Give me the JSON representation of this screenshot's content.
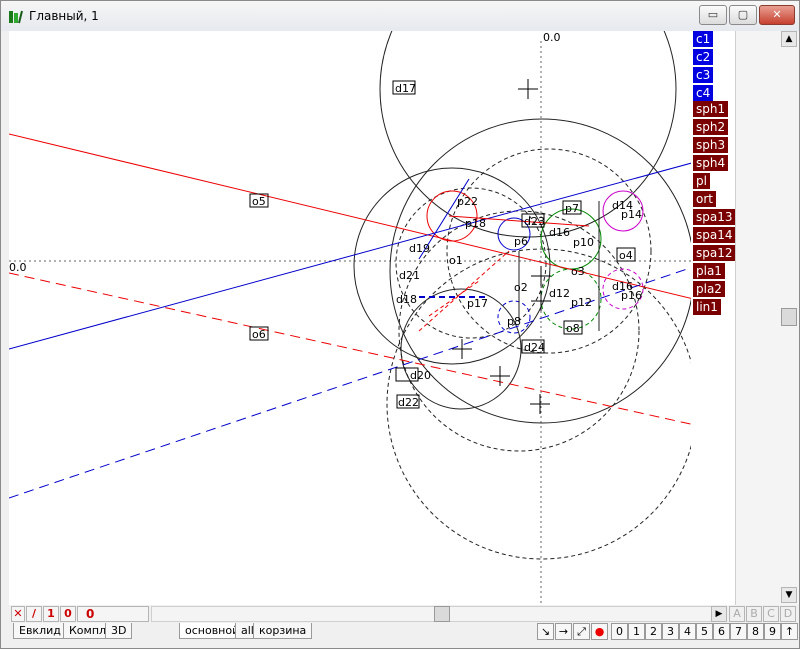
{
  "window": {
    "title": "Главный, 1",
    "min_glyph": "▭",
    "max_glyph": "▢",
    "close_glyph": "✕"
  },
  "canvas": {
    "origin_x_label": "0.0",
    "origin_y_label": "0.0",
    "labels": [
      {
        "id": "d17",
        "text": "d17"
      },
      {
        "id": "o5",
        "text": "o5"
      },
      {
        "id": "o6",
        "text": "o6"
      },
      {
        "id": "d19",
        "text": "d19"
      },
      {
        "id": "d21",
        "text": "d21"
      },
      {
        "id": "d18",
        "text": "d18"
      },
      {
        "id": "d20",
        "text": "d20"
      },
      {
        "id": "d22",
        "text": "d22"
      },
      {
        "id": "d24",
        "text": "d24"
      },
      {
        "id": "p22",
        "text": "p22"
      },
      {
        "id": "p18",
        "text": "p18"
      },
      {
        "id": "d23",
        "text": "d23"
      },
      {
        "id": "p7",
        "text": "p7"
      },
      {
        "id": "d16",
        "text": "d16"
      },
      {
        "id": "p10",
        "text": "p10"
      },
      {
        "id": "d14",
        "text": "d14"
      },
      {
        "id": "p14",
        "text": "p14"
      },
      {
        "id": "o4",
        "text": "o4"
      },
      {
        "id": "o3",
        "text": "o3"
      },
      {
        "id": "o1",
        "text": "o1"
      },
      {
        "id": "o2",
        "text": "o2"
      },
      {
        "id": "d12",
        "text": "d12"
      },
      {
        "id": "p12",
        "text": "p12"
      },
      {
        "id": "d16b",
        "text": "d16"
      },
      {
        "id": "p16",
        "text": "p16"
      },
      {
        "id": "p6",
        "text": "p6"
      },
      {
        "id": "p8",
        "text": "p8"
      },
      {
        "id": "o8",
        "text": "o8"
      },
      {
        "id": "p17",
        "text": "p17"
      }
    ]
  },
  "object_list": [
    {
      "name": "c1",
      "color": "#0000e0"
    },
    {
      "name": "c2",
      "color": "#0000e0"
    },
    {
      "name": "c3",
      "color": "#0000e0"
    },
    {
      "name": "c4",
      "color": "#0000e0"
    },
    {
      "name": "sph1",
      "color": "#7a0000"
    },
    {
      "name": "sph2",
      "color": "#7a0000"
    },
    {
      "name": "sph3",
      "color": "#7a0000"
    },
    {
      "name": "sph4",
      "color": "#7a0000"
    },
    {
      "name": "pl",
      "color": "#7a0000"
    },
    {
      "name": "ort",
      "color": "#7a0000"
    },
    {
      "name": "spa13",
      "color": "#7a0000"
    },
    {
      "name": "spa14",
      "color": "#7a0000"
    },
    {
      "name": "spa12",
      "color": "#7a0000"
    },
    {
      "name": "pla1",
      "color": "#7a0000"
    },
    {
      "name": "pla2",
      "color": "#7a0000"
    },
    {
      "name": "lin1",
      "color": "#7a0000"
    }
  ],
  "toolbar": {
    "tool_x": "✕",
    "tool_line": "/",
    "tool_one": "1",
    "tool_zero": "0",
    "counter": "0",
    "letters": [
      "A",
      "B",
      "C",
      "D"
    ]
  },
  "tabs": [
    {
      "label": "Евклид"
    },
    {
      "label": "Компл."
    },
    {
      "label": "3D"
    },
    {
      "label": "основной"
    },
    {
      "label": "all"
    },
    {
      "label": "корзина"
    }
  ],
  "nav_buttons": [
    "↘",
    "→",
    "⤢",
    "●"
  ],
  "number_buttons": [
    "0",
    "1",
    "2",
    "3",
    "4",
    "5",
    "6",
    "7",
    "8",
    "9",
    "↑"
  ]
}
